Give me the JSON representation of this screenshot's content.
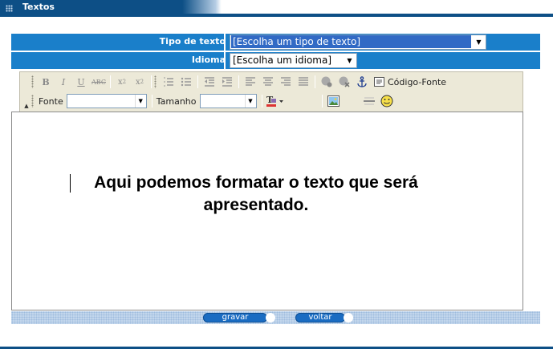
{
  "header": {
    "title": "Textos"
  },
  "form": {
    "tipo_label": "Tipo de texto",
    "tipo_value": "[Escolha um tipo de texto]",
    "idioma_label": "Idioma",
    "idioma_value": "[Escolha um idioma]"
  },
  "toolbar": {
    "source_label": "Código-Fonte",
    "font_label": "Fonte",
    "font_value": "",
    "size_label": "Tamanho",
    "size_value": ""
  },
  "editor": {
    "content": "Aqui podemos formatar o texto que será apresentado."
  },
  "buttons": {
    "save": "gravar",
    "back": "voltar"
  },
  "colors": {
    "brand": "#0d4f86",
    "row": "#1a7fca",
    "selection": "#316ac5"
  }
}
